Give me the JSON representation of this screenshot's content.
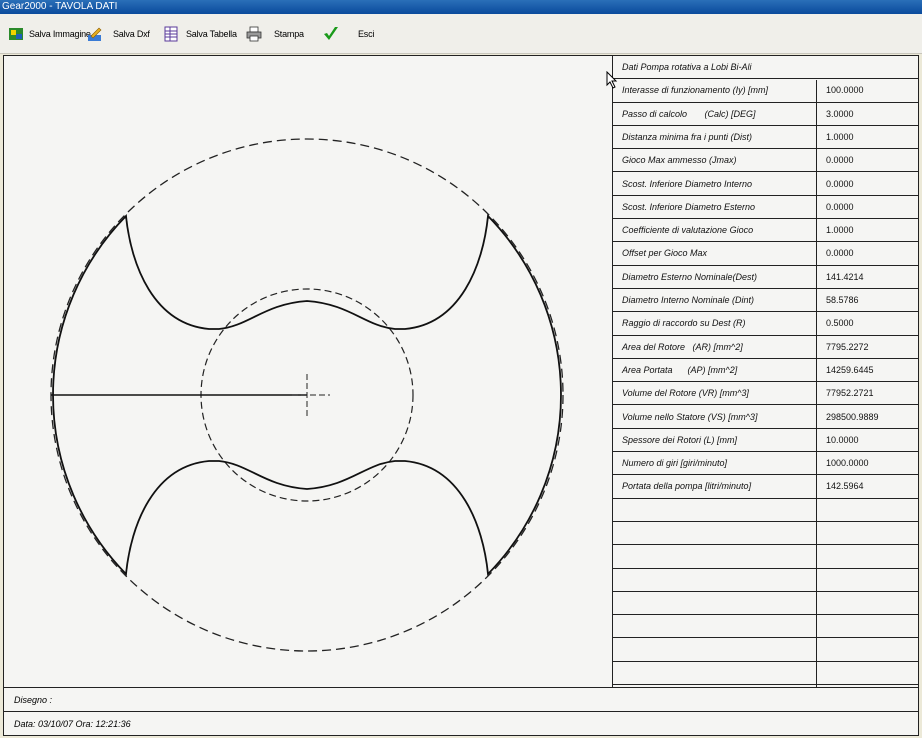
{
  "window": {
    "title": "Gear2000 - TAVOLA DATI"
  },
  "toolbar": {
    "save_image": "Salva Immagine",
    "save_dxf": "Salva Dxf",
    "save_table": "Salva Tabella",
    "print": "Stampa",
    "exit": "Esci"
  },
  "table": {
    "header": "Dati Pompa rotativa a Lobi Bi-Ali",
    "rows": [
      {
        "label": "Interasse di funzionamento (Iy) [mm]",
        "value": "100.0000"
      },
      {
        "label": "Passo di calcolo       (Calc) [DEG]",
        "value": "3.0000"
      },
      {
        "label": "Distanza minima fra i punti (Dist)",
        "value": "1.0000"
      },
      {
        "label": "Gioco Max ammesso (Jmax)",
        "value": "0.0000"
      },
      {
        "label": "Scost. Inferiore Diametro Interno",
        "value": "0.0000"
      },
      {
        "label": "Scost. Inferiore Diametro Esterno",
        "value": "0.0000"
      },
      {
        "label": "Coefficiente di valutazione Gioco",
        "value": "1.0000"
      },
      {
        "label": "Offset per Gioco Max",
        "value": "0.0000"
      },
      {
        "label": "Diametro Esterno Nominale(Dest)",
        "value": "141.4214"
      },
      {
        "label": "Diametro Interno Nominale (Dint)",
        "value": "58.5786"
      },
      {
        "label": "Raggio di raccordo su Dest (R)",
        "value": "0.5000"
      },
      {
        "label": "Area del Rotore   (AR) [mm^2]",
        "value": "7795.2272"
      },
      {
        "label": "Area Portata      (AP) [mm^2]",
        "value": "14259.6445"
      },
      {
        "label": "Volume del Rotore (VR) [mm^3]",
        "value": "77952.2721"
      },
      {
        "label": "Volume nello Statore (VS) [mm^3]",
        "value": "298500.9889"
      },
      {
        "label": "Spessore dei Rotori (L) [mm]",
        "value": "10.0000"
      },
      {
        "label": "Numero di giri [giri/minuto]",
        "value": "1000.0000"
      },
      {
        "label": "Portata della pompa [litri/minuto]",
        "value": "142.5964"
      }
    ],
    "empty_rows": 8
  },
  "footer": {
    "drawing_label": "Disegno :",
    "date_line": "Data: 03/10/07 Ora: 12:21:36"
  },
  "colors": {
    "titlebar": "#0a4a9c",
    "line": "#222222",
    "panel": "#f5f5f3"
  }
}
